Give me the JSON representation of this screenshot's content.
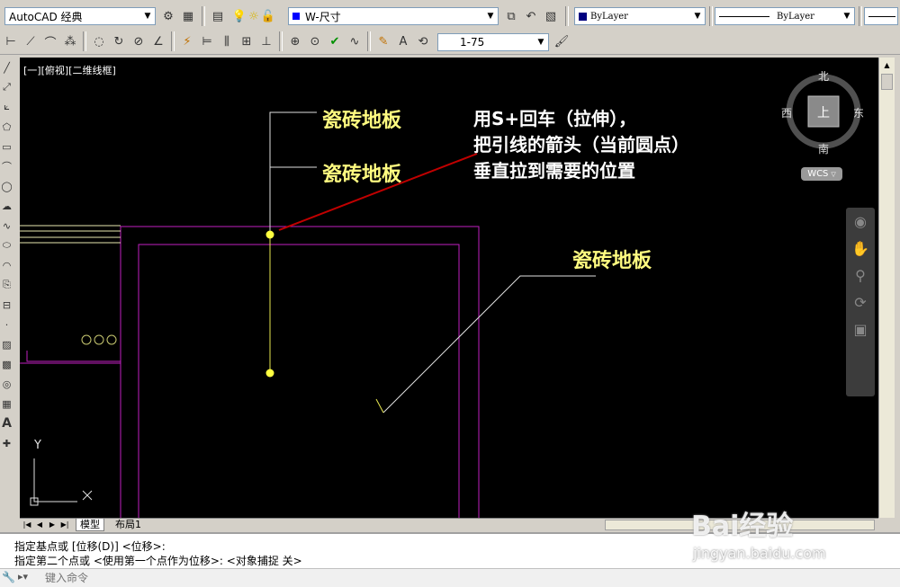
{
  "toolbar1": {
    "workspace": "AutoCAD 经典",
    "layer": "W-尺寸",
    "color": "ByLayer",
    "linetype": "ByLayer"
  },
  "toolbar2": {
    "dimstyle": "1-75"
  },
  "canvas": {
    "view_label": "[一][俯视][二维线框]",
    "labels": [
      "瓷砖地板",
      "瓷砖地板",
      "瓷砖地板"
    ],
    "annotation": [
      "用S+回车（拉伸），",
      "把引线的箭头（当前圆点）",
      "垂直拉到需要的位置"
    ],
    "viewcube": {
      "north": "北",
      "south": "南",
      "east": "东",
      "west": "西",
      "top": "上",
      "wcs": "WCS"
    },
    "ucs": {
      "x": "X",
      "y": "Y"
    }
  },
  "tabs": {
    "model": "模型",
    "layout": "布局1"
  },
  "command": {
    "line1": "指定基点或 [位移(D)] <位移>:",
    "line2": "指定第二个点或 <使用第一个点作为位移>:  <对象捕捉 关>",
    "placeholder": "键入命令"
  },
  "watermark": {
    "brand": "Bai经验",
    "url": "jingyan.baidu.com"
  },
  "colors": {
    "canvas_bg": "#000000",
    "label_yellow": "#fffb80",
    "wall_magenta": "#c020c0",
    "arrow_red": "#c00000",
    "leader_yellow": "#ffff40"
  }
}
